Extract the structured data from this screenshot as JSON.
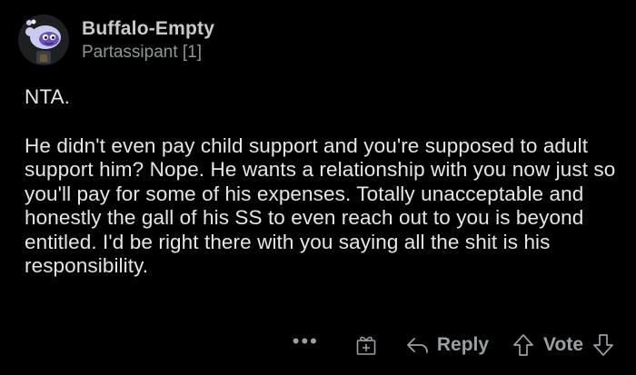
{
  "comment": {
    "author": "Buffalo-Empty",
    "flair": "Partassipant [1]",
    "paragraphs": [
      "NTA.",
      "He didn't even pay child support and you're supposed to adult support him? Nope. He wants a relationship with you now just so you'll pay for some of his expenses. Totally unacceptable and honestly the gall of his SS to even reach out to you is beyond entitled. I'd be right there with you saying all the shit is his responsibility."
    ]
  },
  "actions": {
    "more_label": "•••",
    "reply_label": "Reply",
    "vote_label": "Vote"
  },
  "icons": {
    "more": "more-options-icon",
    "award": "award-gift-icon",
    "reply": "reply-arrow-icon",
    "upvote": "upvote-arrow-icon",
    "downvote": "downvote-arrow-icon"
  },
  "colors": {
    "background": "#000000",
    "body_text": "#e4e6e7",
    "muted": "#8f9496"
  }
}
